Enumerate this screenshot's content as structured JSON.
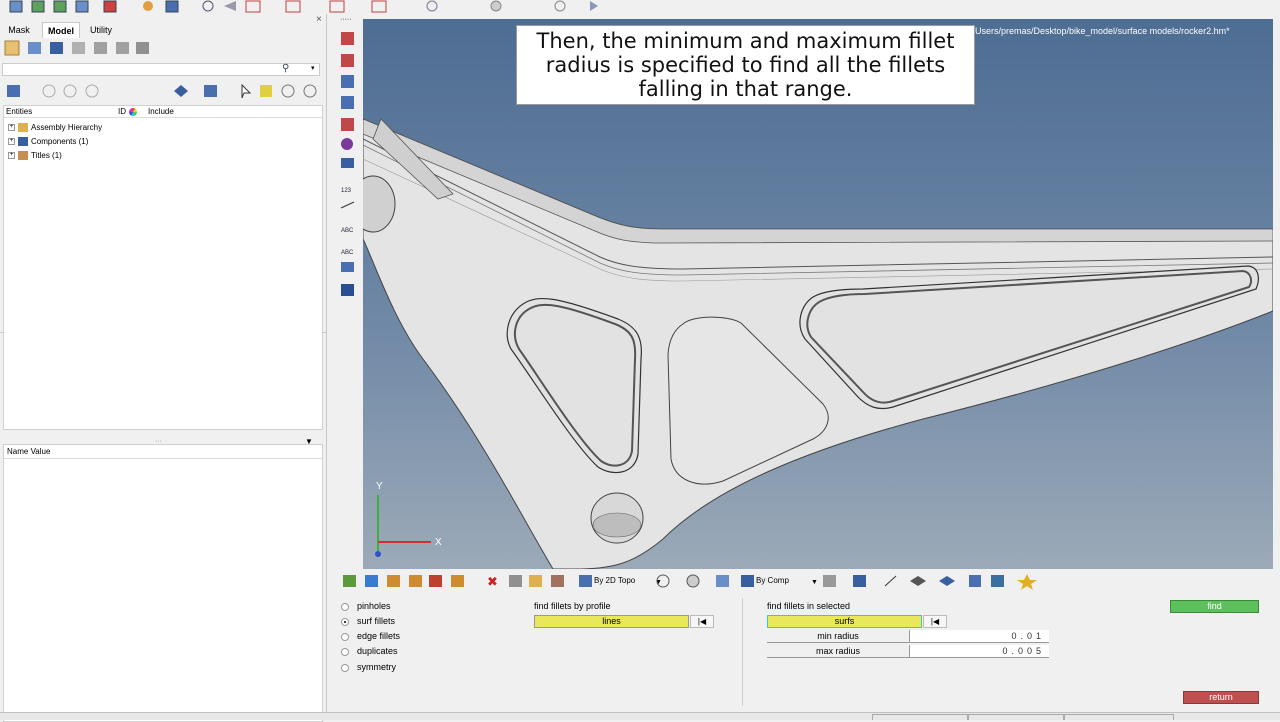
{
  "tabs": [
    {
      "label": "Mask"
    },
    {
      "label": "Model"
    },
    {
      "label": "Utility"
    }
  ],
  "tree": {
    "headers": {
      "entities": "Entities",
      "id": "ID",
      "include": "Include"
    },
    "items": [
      {
        "label": "Assembly Hierarchy"
      },
      {
        "label": "Components (1)"
      },
      {
        "label": "Titles (1)"
      }
    ]
  },
  "props": {
    "header": "Name Value"
  },
  "viewport": {
    "caption_line1": "Then, the minimum and maximum fillet",
    "caption_line2": "radius is specified to find all the fillets",
    "caption_line3": "falling in that range.",
    "file_path": "Users/premas/Desktop/bike_model/surface models/rocker2.hm*",
    "axis_y": "Y",
    "axis_x": "X"
  },
  "bottom_toolbar": {
    "topo_mode": "By 2D Topo",
    "comp_mode": "By Comp"
  },
  "panel": {
    "options": [
      {
        "label": "pinholes",
        "selected": false
      },
      {
        "label": "surf fillets",
        "selected": true
      },
      {
        "label": "edge fillets",
        "selected": false
      },
      {
        "label": "duplicates",
        "selected": false
      },
      {
        "label": "symmetry",
        "selected": false
      }
    ],
    "profile_title": "find fillets by profile",
    "profile_selector": "lines",
    "selected_title": "find fillets in selected",
    "selected_selector": "surfs",
    "min_radius_label": "min radius",
    "min_radius_value": "0.01",
    "max_radius_label": "max radius",
    "max_radius_value": "0.005",
    "find_label": "find",
    "return_label": "return"
  },
  "colors": {
    "selector": "#e8e85a",
    "find": "#5cc05c",
    "return": "#c05050",
    "viewport_top": "#4e6d93",
    "viewport_bottom": "#9caab8"
  }
}
